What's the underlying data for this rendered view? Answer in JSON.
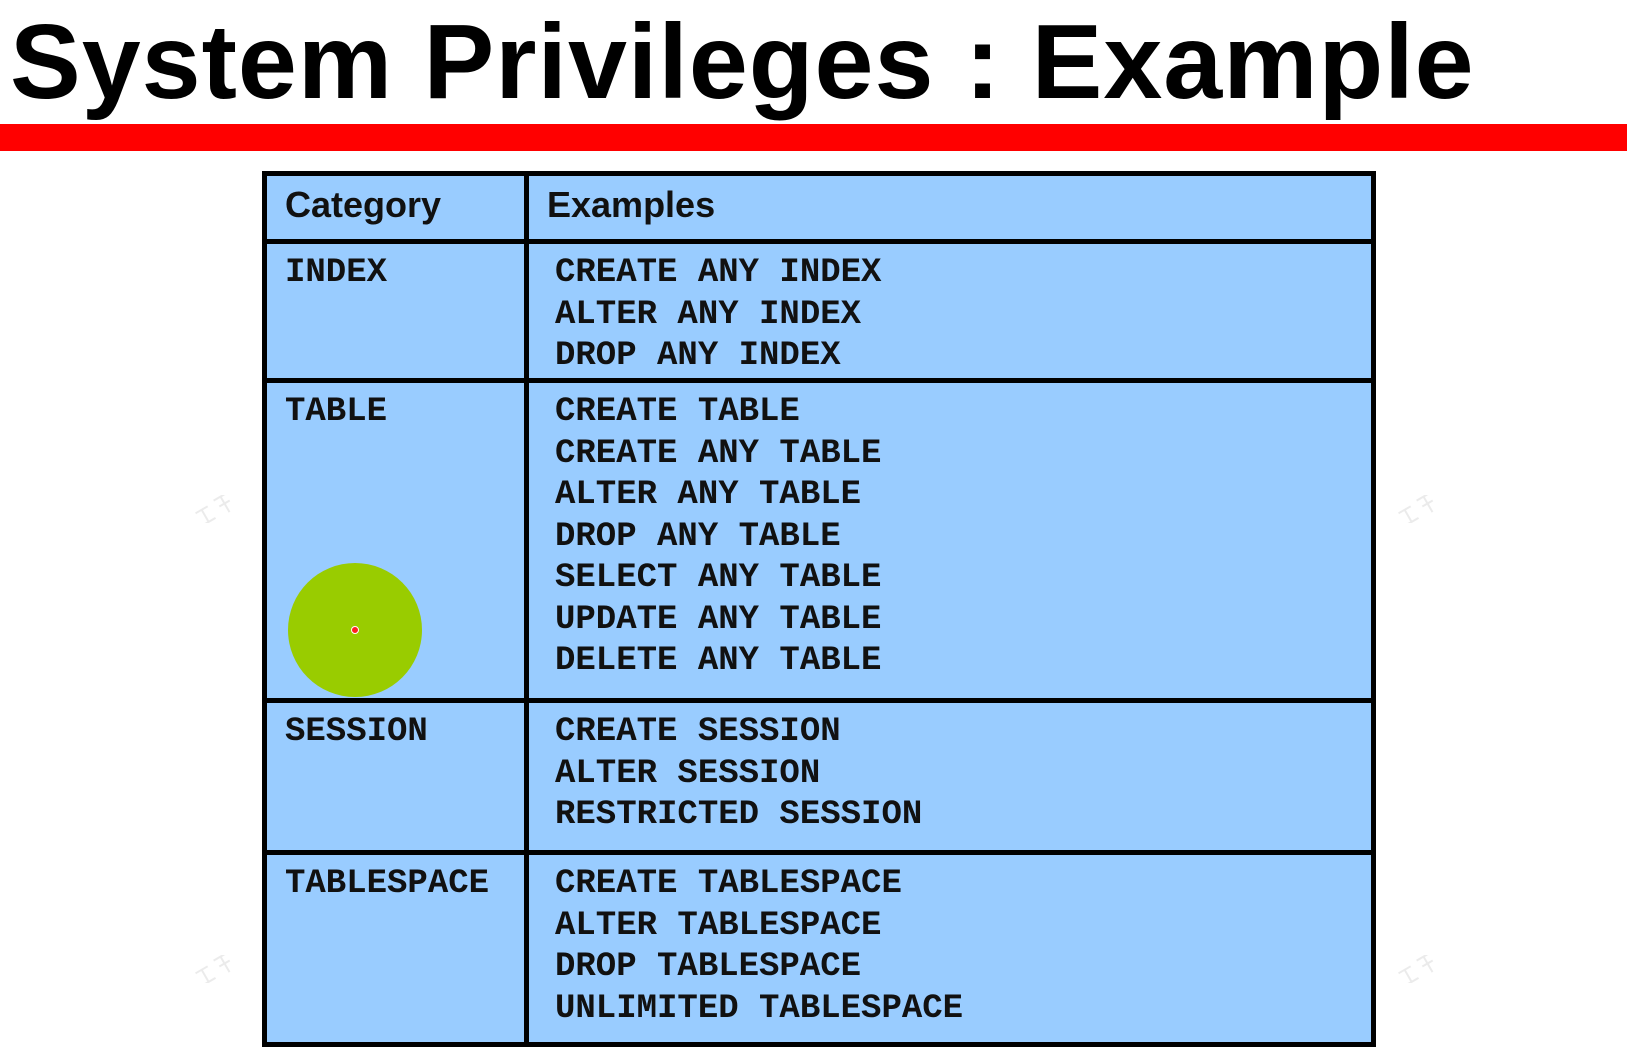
{
  "title": "System Privileges : Example",
  "colors": {
    "title_rule": "#ff0000",
    "table_background": "#99ccff",
    "table_border": "#000000",
    "cursor_highlight": "#99cc00"
  },
  "table": {
    "headers": {
      "category": "Category",
      "examples": "Examples"
    },
    "rows": [
      {
        "category": "INDEX",
        "examples": [
          "CREATE ANY INDEX",
          "ALTER ANY INDEX",
          "DROP ANY INDEX"
        ]
      },
      {
        "category": "TABLE",
        "examples": [
          "CREATE TABLE",
          "CREATE ANY TABLE",
          "ALTER ANY TABLE",
          "DROP ANY TABLE",
          "SELECT ANY TABLE",
          "UPDATE ANY TABLE",
          "DELETE ANY TABLE"
        ]
      },
      {
        "category": "SESSION",
        "examples": [
          "CREATE SESSION",
          "ALTER SESSION",
          "RESTRICTED SESSION"
        ]
      },
      {
        "category": "TABLESPACE",
        "examples": [
          "CREATE TABLESPACE",
          "ALTER TABLESPACE",
          "DROP TABLESPACE",
          "UNLIMITED TABLESPACE"
        ]
      }
    ]
  }
}
